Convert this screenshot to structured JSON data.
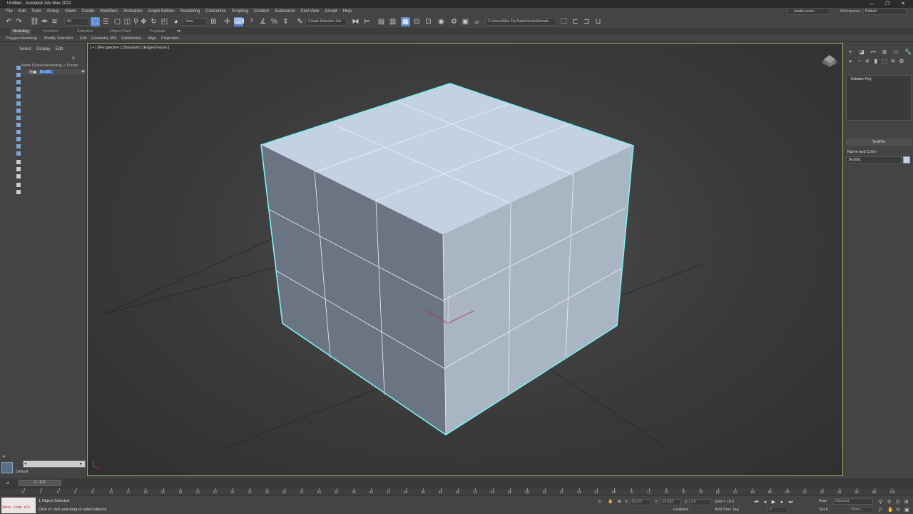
{
  "window": {
    "title": "Untitled - Autodesk 3ds Max 2022",
    "minimize": "—",
    "maximize": "❐",
    "close": "✕"
  },
  "menu": [
    "File",
    "Edit",
    "Tools",
    "Group",
    "Views",
    "Create",
    "Modifiers",
    "Animation",
    "Graph Editors",
    "Rendering",
    "Customize",
    "Scripting",
    "Content",
    "Substance",
    "Civil View",
    "Arnold",
    "Help"
  ],
  "user": {
    "name": "martin.coven"
  },
  "workspace": {
    "label": "Workspaces:",
    "value": "Default"
  },
  "toolbar": {
    "selection_filter": "All",
    "ref_coord": "View",
    "named_selection": "Create Selection Set",
    "project_path": "C:\\Users\\Max Zip Builds\\SmartExtrude"
  },
  "ribbon": {
    "tabs": [
      "Modeling",
      "Freeform",
      "Selection",
      "Object Paint",
      "Populate"
    ],
    "active_tab": "Modeling",
    "sub_items": [
      "Polygon Modeling",
      "Modify Selection",
      "Edit",
      "Geometry (All)",
      "Subdivision",
      "Align",
      "Properties"
    ]
  },
  "scene_explorer": {
    "tabs": [
      "Select",
      "Display",
      "Edit"
    ],
    "column_header": "Name (Sorted Ascending)  △ Frozen",
    "objects": [
      {
        "name": "Box001"
      }
    ],
    "layer": "Default"
  },
  "viewport": {
    "label": "[ + ] [Perspective ] [Standard ] [Edged Faces ]"
  },
  "command_panel": {
    "modifier_stack": [
      "Editable Poly"
    ],
    "test_button": "TestFile",
    "rollout_title": "Name and Color",
    "object_name": "Box001",
    "object_color": "#c2d2ea"
  },
  "timeline": {
    "frame_display": "0 / 100",
    "ticks": [
      "0",
      "2",
      "4",
      "6",
      "8",
      "10",
      "12",
      "14",
      "16",
      "18",
      "20",
      "22",
      "24",
      "26",
      "28",
      "30",
      "32",
      "34",
      "36",
      "38",
      "40",
      "42",
      "44",
      "46",
      "48",
      "50",
      "52",
      "54",
      "56",
      "58",
      "60",
      "62",
      "64",
      "66",
      "68",
      "70",
      "72",
      "74",
      "76",
      "78",
      "80",
      "82",
      "84",
      "86",
      "88",
      "90",
      "92",
      "94",
      "96",
      "98",
      "100"
    ]
  },
  "status": {
    "maxscript_text": "Xeno item alt",
    "line1": "1 Object Selected",
    "line2": "Click or click-and-drag to select objects",
    "x_label": "X:",
    "x_value": "39.372",
    "y_label": "Y:",
    "y_value": "-19.683",
    "z_label": "Z:",
    "z_value": "0.0",
    "grid": "Grid = 10.0",
    "enabled": "Enabled:",
    "add_time_tag": "Add Time Tag",
    "auto": "Auto",
    "set_key": "Set K.",
    "selected": "Selected",
    "filters": "Filters...",
    "current_frame": "0"
  }
}
